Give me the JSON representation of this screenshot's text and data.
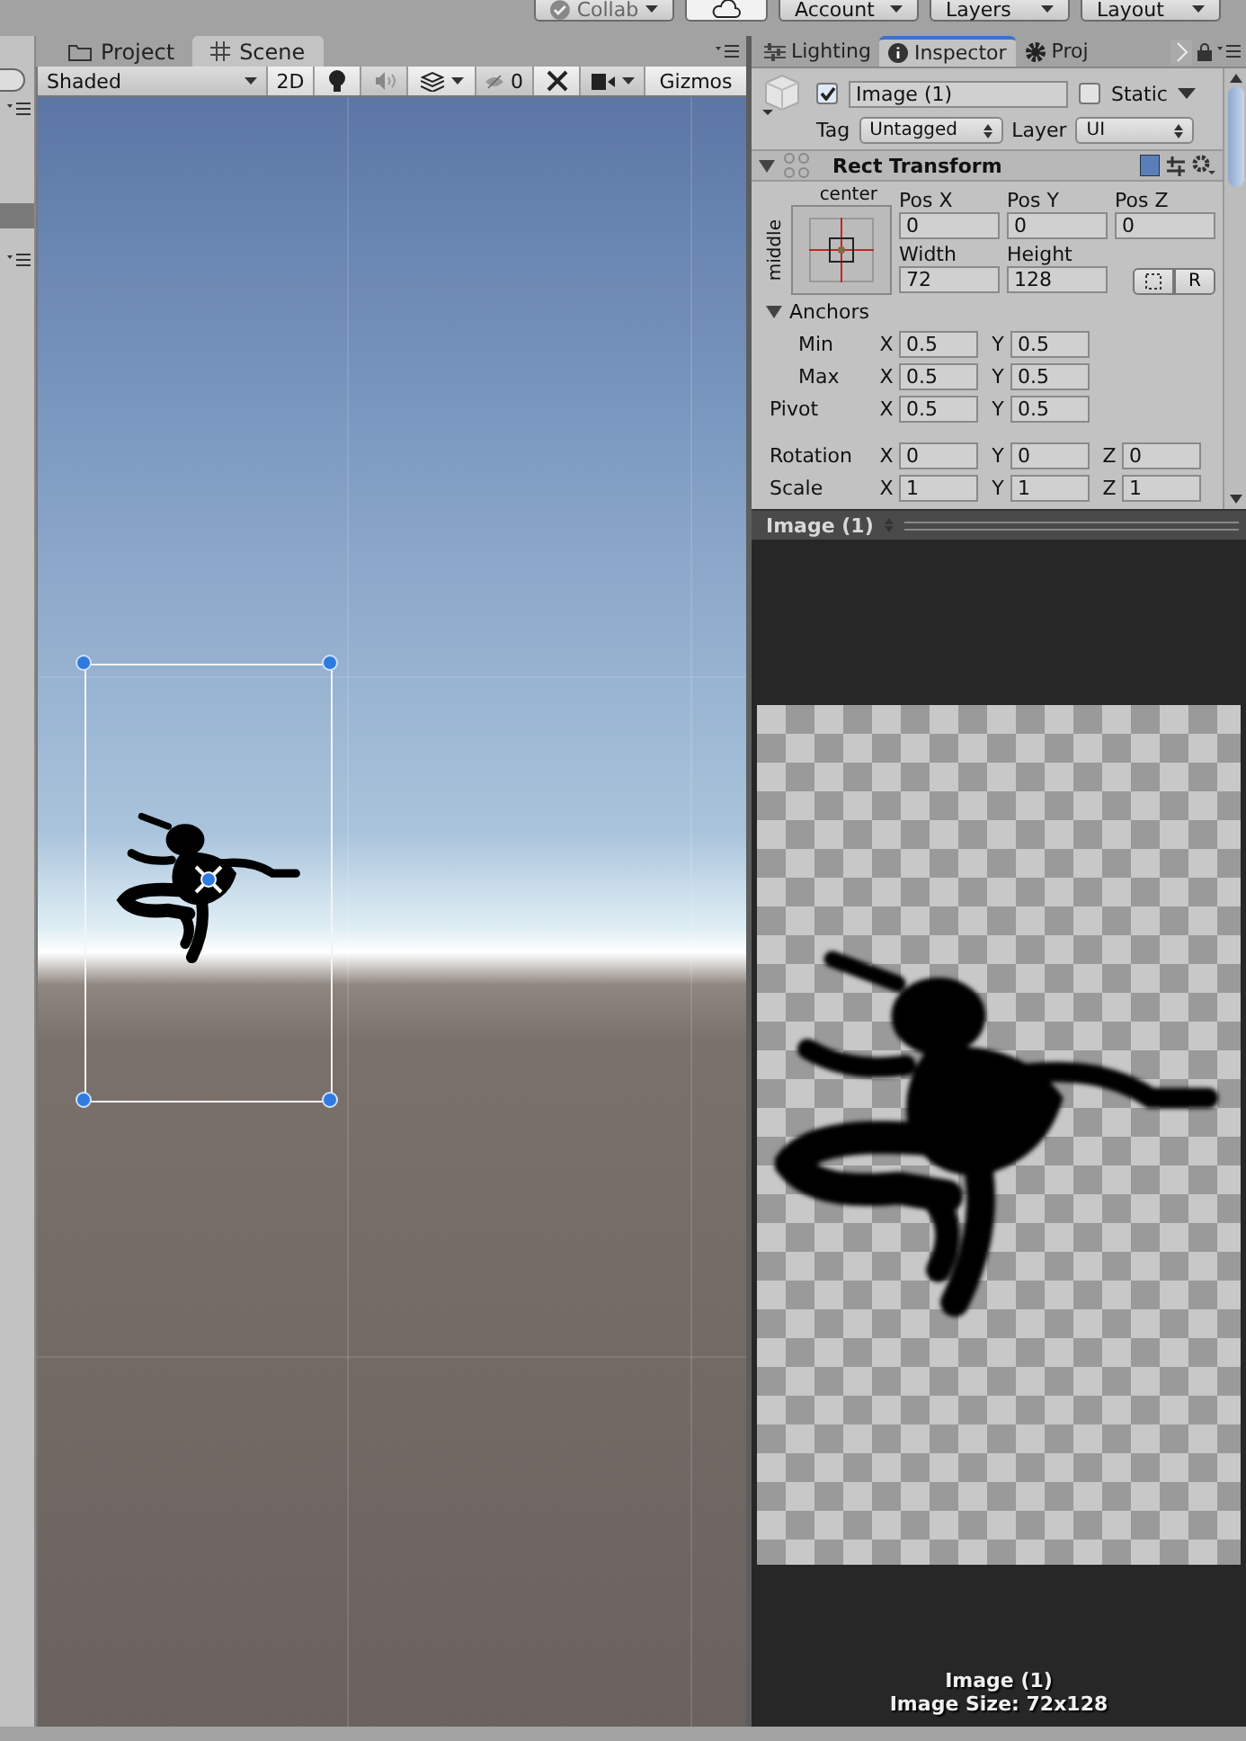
{
  "toolbar": {
    "buttons": [
      {
        "kind": "collab",
        "label": "Collab"
      },
      {
        "kind": "cloud"
      },
      {
        "kind": "dropdown",
        "label": "Account"
      },
      {
        "kind": "dropdown",
        "label": "Layers"
      },
      {
        "kind": "dropdown",
        "label": "Layout"
      }
    ]
  },
  "scene_panel": {
    "tabs": [
      {
        "label": "Project",
        "selected": false
      },
      {
        "label": "Scene",
        "selected": true
      }
    ],
    "toolbar": {
      "shading": "Shaded",
      "mode_2d": "2D",
      "mode_2d_on": true,
      "lighting_on": true,
      "audio_on": false,
      "tools_on": true,
      "hidden_count": "0",
      "gizmos": "Gizmos"
    }
  },
  "inspector": {
    "tabs": [
      {
        "label": "Lighting",
        "selected": false
      },
      {
        "label": "Inspector",
        "selected": true
      },
      {
        "label": "Proj",
        "selected": false
      }
    ],
    "object": {
      "active": true,
      "name": "Image (1)",
      "static": false,
      "static_label": "Static",
      "tag_label": "Tag",
      "tag": "Untagged",
      "layer_label": "Layer",
      "layer": "UI"
    },
    "rect_transform": {
      "title": "Rect Transform",
      "expanded": true,
      "anchor_h": "center",
      "anchor_v": "middle",
      "grid": [
        {
          "label": "Pos X",
          "value": "0"
        },
        {
          "label": "Pos Y",
          "value": "0"
        },
        {
          "label": "Pos Z",
          "value": "0"
        },
        {
          "label": "Width",
          "value": "72"
        },
        {
          "label": "Height",
          "value": "128"
        }
      ],
      "reset_label": "R",
      "anchors": {
        "label": "Anchors",
        "expanded": true
      },
      "rows": [
        {
          "kind": "sub",
          "label": "Min",
          "components": [
            {
              "axis": "X",
              "value": "0.5"
            },
            {
              "axis": "Y",
              "value": "0.5"
            }
          ]
        },
        {
          "kind": "sub",
          "label": "Max",
          "components": [
            {
              "axis": "X",
              "value": "0.5"
            },
            {
              "axis": "Y",
              "value": "0.5"
            }
          ]
        },
        {
          "kind": "main",
          "label": "Pivot",
          "components": [
            {
              "axis": "X",
              "value": "0.5"
            },
            {
              "axis": "Y",
              "value": "0.5"
            }
          ]
        },
        {
          "kind": "gap"
        },
        {
          "kind": "main",
          "label": "Rotation",
          "components": [
            {
              "axis": "X",
              "value": "0"
            },
            {
              "axis": "Y",
              "value": "0"
            },
            {
              "axis": "Z",
              "value": "0"
            }
          ]
        },
        {
          "kind": "main",
          "label": "Scale",
          "components": [
            {
              "axis": "X",
              "value": "1"
            },
            {
              "axis": "Y",
              "value": "1"
            },
            {
              "axis": "Z",
              "value": "1"
            }
          ]
        }
      ]
    }
  },
  "preview": {
    "title": "Image (1)",
    "caption": "Image (1)",
    "size": "Image Size: 72x128"
  }
}
